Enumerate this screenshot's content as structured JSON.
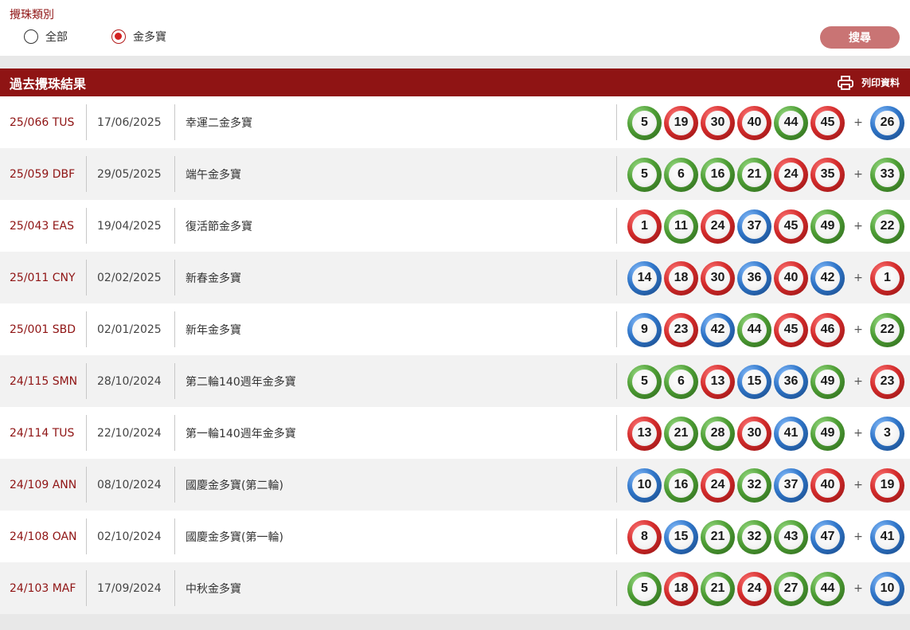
{
  "filter": {
    "title": "攪珠類別",
    "options": [
      {
        "label": "全部",
        "checked": false
      },
      {
        "label": "金多寶",
        "checked": true
      }
    ],
    "search_label": "搜尋"
  },
  "results": {
    "title": "過去攪珠結果",
    "print_label": "列印資料",
    "rows": [
      {
        "draw": "25/066 TUS",
        "date": "17/06/2025",
        "name": "幸運二金多寶",
        "balls": [
          {
            "n": "5",
            "c": "green"
          },
          {
            "n": "19",
            "c": "red"
          },
          {
            "n": "30",
            "c": "red"
          },
          {
            "n": "40",
            "c": "red"
          },
          {
            "n": "44",
            "c": "green"
          },
          {
            "n": "45",
            "c": "red"
          }
        ],
        "extra": {
          "n": "26",
          "c": "blue"
        }
      },
      {
        "draw": "25/059 DBF",
        "date": "29/05/2025",
        "name": "端午金多寶",
        "balls": [
          {
            "n": "5",
            "c": "green"
          },
          {
            "n": "6",
            "c": "green"
          },
          {
            "n": "16",
            "c": "green"
          },
          {
            "n": "21",
            "c": "green"
          },
          {
            "n": "24",
            "c": "red"
          },
          {
            "n": "35",
            "c": "red"
          }
        ],
        "extra": {
          "n": "33",
          "c": "green"
        }
      },
      {
        "draw": "25/043 EAS",
        "date": "19/04/2025",
        "name": "復活節金多寶",
        "balls": [
          {
            "n": "1",
            "c": "red"
          },
          {
            "n": "11",
            "c": "green"
          },
          {
            "n": "24",
            "c": "red"
          },
          {
            "n": "37",
            "c": "blue"
          },
          {
            "n": "45",
            "c": "red"
          },
          {
            "n": "49",
            "c": "green"
          }
        ],
        "extra": {
          "n": "22",
          "c": "green"
        }
      },
      {
        "draw": "25/011 CNY",
        "date": "02/02/2025",
        "name": "新春金多寶",
        "balls": [
          {
            "n": "14",
            "c": "blue"
          },
          {
            "n": "18",
            "c": "red"
          },
          {
            "n": "30",
            "c": "red"
          },
          {
            "n": "36",
            "c": "blue"
          },
          {
            "n": "40",
            "c": "red"
          },
          {
            "n": "42",
            "c": "blue"
          }
        ],
        "extra": {
          "n": "1",
          "c": "red"
        }
      },
      {
        "draw": "25/001 SBD",
        "date": "02/01/2025",
        "name": "新年金多寶",
        "balls": [
          {
            "n": "9",
            "c": "blue"
          },
          {
            "n": "23",
            "c": "red"
          },
          {
            "n": "42",
            "c": "blue"
          },
          {
            "n": "44",
            "c": "green"
          },
          {
            "n": "45",
            "c": "red"
          },
          {
            "n": "46",
            "c": "red"
          }
        ],
        "extra": {
          "n": "22",
          "c": "green"
        }
      },
      {
        "draw": "24/115 SMN",
        "date": "28/10/2024",
        "name": "第二輪140週年金多寶",
        "balls": [
          {
            "n": "5",
            "c": "green"
          },
          {
            "n": "6",
            "c": "green"
          },
          {
            "n": "13",
            "c": "red"
          },
          {
            "n": "15",
            "c": "blue"
          },
          {
            "n": "36",
            "c": "blue"
          },
          {
            "n": "49",
            "c": "green"
          }
        ],
        "extra": {
          "n": "23",
          "c": "red"
        }
      },
      {
        "draw": "24/114 TUS",
        "date": "22/10/2024",
        "name": "第一輪140週年金多寶",
        "balls": [
          {
            "n": "13",
            "c": "red"
          },
          {
            "n": "21",
            "c": "green"
          },
          {
            "n": "28",
            "c": "green"
          },
          {
            "n": "30",
            "c": "red"
          },
          {
            "n": "41",
            "c": "blue"
          },
          {
            "n": "49",
            "c": "green"
          }
        ],
        "extra": {
          "n": "3",
          "c": "blue"
        }
      },
      {
        "draw": "24/109 ANN",
        "date": "08/10/2024",
        "name": "國慶金多寶(第二輪)",
        "balls": [
          {
            "n": "10",
            "c": "blue"
          },
          {
            "n": "16",
            "c": "green"
          },
          {
            "n": "24",
            "c": "red"
          },
          {
            "n": "32",
            "c": "green"
          },
          {
            "n": "37",
            "c": "blue"
          },
          {
            "n": "40",
            "c": "red"
          }
        ],
        "extra": {
          "n": "19",
          "c": "red"
        }
      },
      {
        "draw": "24/108 OAN",
        "date": "02/10/2024",
        "name": "國慶金多寶(第一輪)",
        "balls": [
          {
            "n": "8",
            "c": "red"
          },
          {
            "n": "15",
            "c": "blue"
          },
          {
            "n": "21",
            "c": "green"
          },
          {
            "n": "32",
            "c": "green"
          },
          {
            "n": "43",
            "c": "green"
          },
          {
            "n": "47",
            "c": "blue"
          }
        ],
        "extra": {
          "n": "41",
          "c": "blue"
        }
      },
      {
        "draw": "24/103 MAF",
        "date": "17/09/2024",
        "name": "中秋金多寶",
        "balls": [
          {
            "n": "5",
            "c": "green"
          },
          {
            "n": "18",
            "c": "red"
          },
          {
            "n": "21",
            "c": "green"
          },
          {
            "n": "24",
            "c": "red"
          },
          {
            "n": "27",
            "c": "green"
          },
          {
            "n": "44",
            "c": "green"
          }
        ],
        "extra": {
          "n": "10",
          "c": "blue"
        }
      }
    ]
  },
  "colors": {
    "brand": "#8f1414",
    "search_button": "#c97474",
    "ball_red": "#d42c2c",
    "ball_green": "#4e9e35",
    "ball_blue": "#3076c9"
  },
  "icons": {
    "print": "printer-icon"
  }
}
